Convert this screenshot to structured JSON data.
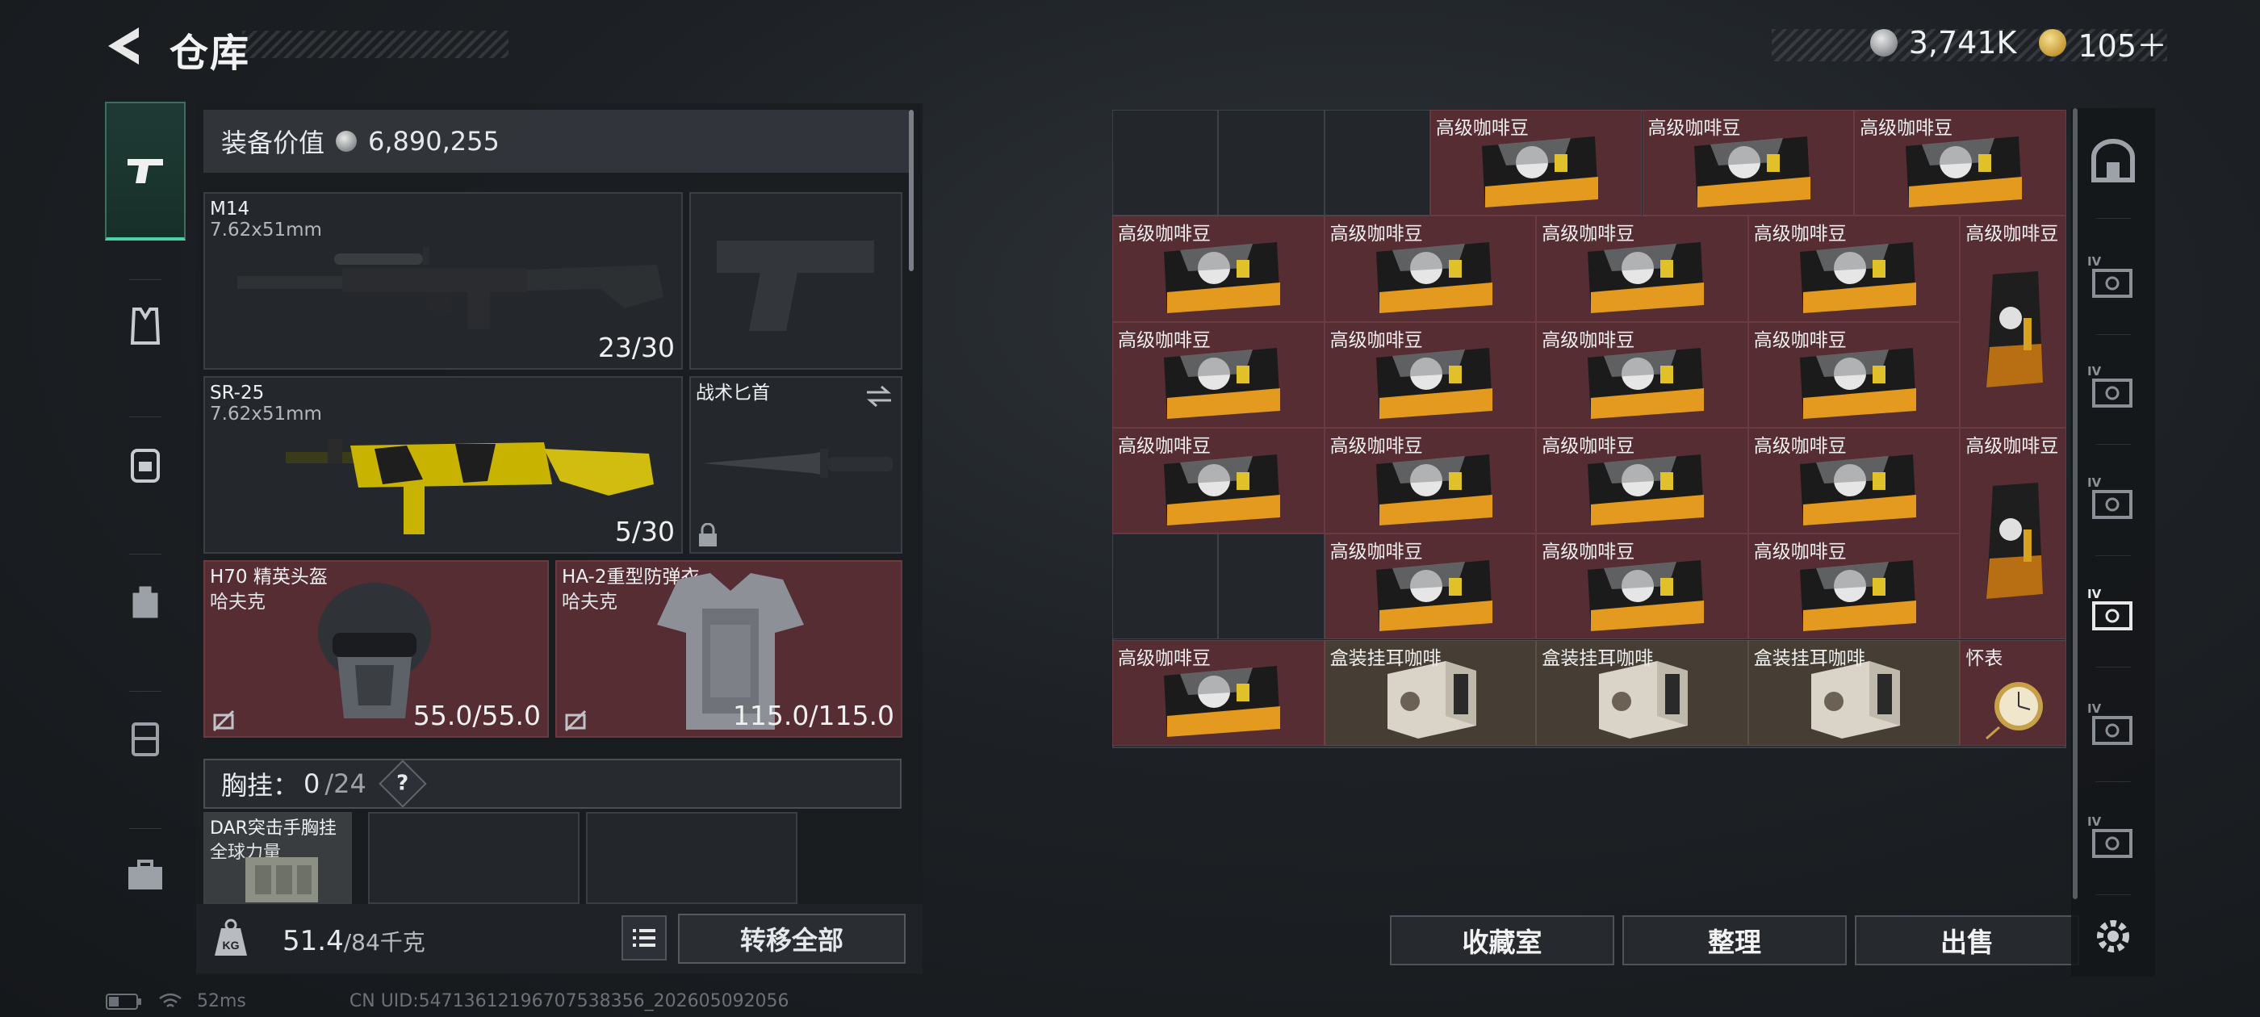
{
  "header": {
    "title": "仓库"
  },
  "currency": {
    "silver": "3,741K",
    "gold": "105＋"
  },
  "equipment": {
    "value_label": "装备价值",
    "value": "6,890,255",
    "primary": {
      "name": "M14",
      "caliber": "7.62x51mm",
      "ammo": "23/30"
    },
    "secondary": {
      "name": "SR-25",
      "caliber": "7.62x51mm",
      "ammo": "5/30"
    },
    "melee": {
      "name": "战术匕首"
    },
    "helmet": {
      "name": "H70 精英头盔",
      "brand": "哈夫克",
      "durability": "55.0/55.0"
    },
    "armor": {
      "name": "HA-2重型防弹衣",
      "brand": "哈夫克",
      "durability": "115.0/115.0"
    },
    "chest_rig": {
      "label": "胸挂：",
      "current": "0",
      "capacity": "/24",
      "help": "?"
    },
    "rig_item": {
      "name": "DAR突击手胸挂",
      "brand": "全球力量"
    }
  },
  "weight": {
    "current": "51.4",
    "max": "/84千克"
  },
  "buttons": {
    "transfer_all": "转移全部",
    "collection": "收藏室",
    "organize": "整理",
    "sell": "出售"
  },
  "status": {
    "ping": "52ms",
    "uid": "CN UID:54713612196707538356_202605092056"
  },
  "grid_items": {
    "coffee": "高级咖啡豆",
    "boxed_coffee": "盒装挂耳咖啡",
    "pocket_watch": "怀表"
  },
  "right_tabs": {
    "iv": "IV"
  },
  "colors": {
    "accent": "#49d3a5",
    "item_red": "#552d33",
    "item_beige": "#463e34"
  }
}
